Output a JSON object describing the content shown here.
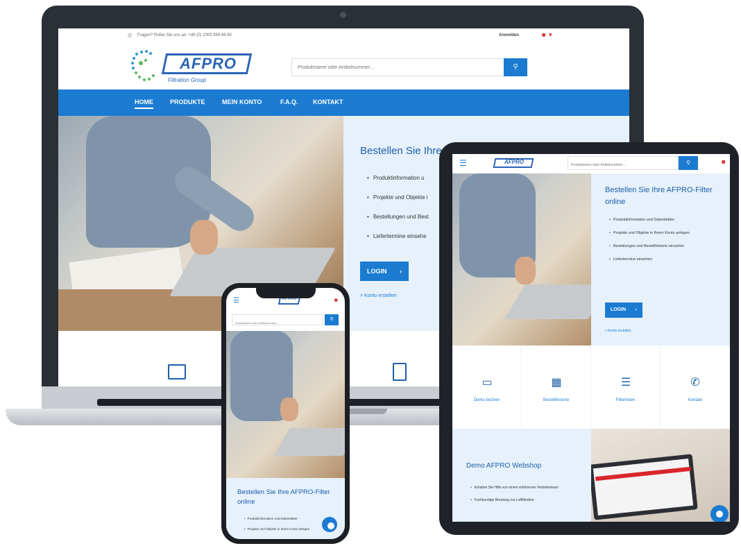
{
  "colors": {
    "brand_blue": "#1a7bd1",
    "logo_blue": "#2a63b6",
    "panel_bg": "#e6f1fb",
    "user_red": "#d9262b"
  },
  "desktop": {
    "topbar": {
      "hotline": "Fragen? Rufen Sie uns an: +49 (0) 2303 959 89 80",
      "signin": "Anmelden",
      "user_icon": "user-icon"
    },
    "logo": {
      "name": "AFPRO",
      "tagline": "Filtration Group"
    },
    "search": {
      "placeholder": "Produktname oder Artikelnummer...",
      "button_icon": "search-icon"
    },
    "nav": [
      "HOME",
      "PRODUKTE",
      "MEIN KONTO",
      "F.A.Q.",
      "KONTAKT"
    ],
    "hero": {
      "title": "Bestellen Sie Ihre",
      "bullets": [
        "Produktinformation u",
        "Projekte und Objekte i",
        "Bestellungen und Best",
        "Liefertermine einsehe"
      ],
      "login_label": "LOGIN",
      "arrow": "›",
      "account_link": "> Konto erstellen"
    }
  },
  "tablet": {
    "logo": "AFPRO",
    "search_placeholder": "Produktname oder Artikelnummer...",
    "hero": {
      "title": "Bestellen Sie Ihre AFPRO-Filter online",
      "bullets": [
        "Produktinformation und Datenblätter",
        "Projekte und Objekte in Ihrem Konto anlegen",
        "Bestellungen und Bestellhistorie einsehen",
        "Liefertermine einsehen"
      ],
      "login_label": "LOGIN",
      "arrow": "›",
      "account_link": "» Konto erstellen"
    },
    "features": [
      {
        "label": "Demo buchen",
        "icon": "presentation-icon"
      },
      {
        "label": "Bestellhistorie",
        "icon": "calendar-icon"
      },
      {
        "label": "Filterlisten",
        "icon": "checklist-icon"
      },
      {
        "label": "Kontakt",
        "icon": "phone-icon"
      }
    ],
    "demo": {
      "title": "Demo AFPRO Webshop",
      "bullets": [
        "Erhalten Sie Hilfe von einem erfahrenen Vertriebsteam",
        "Fachkundige Beratung zur Luftfiltration"
      ]
    }
  },
  "phone": {
    "logo": "AFPRO",
    "search_placeholder": "Produktname oder Artikelnummer...",
    "hero": {
      "title": "Bestellen Sie Ihre AFPRO-Filter online",
      "bullets": [
        "Produktinformation und Datenblätter",
        "Projekte und Objekte in Ihrem Konto anlegen"
      ]
    }
  },
  "glyphs": {
    "search": "🔍",
    "user": "👤",
    "phone": "📞",
    "menu": "☰",
    "presentation": "📽",
    "calendar": "📅",
    "checklist": "📋",
    "contact": "✆"
  }
}
